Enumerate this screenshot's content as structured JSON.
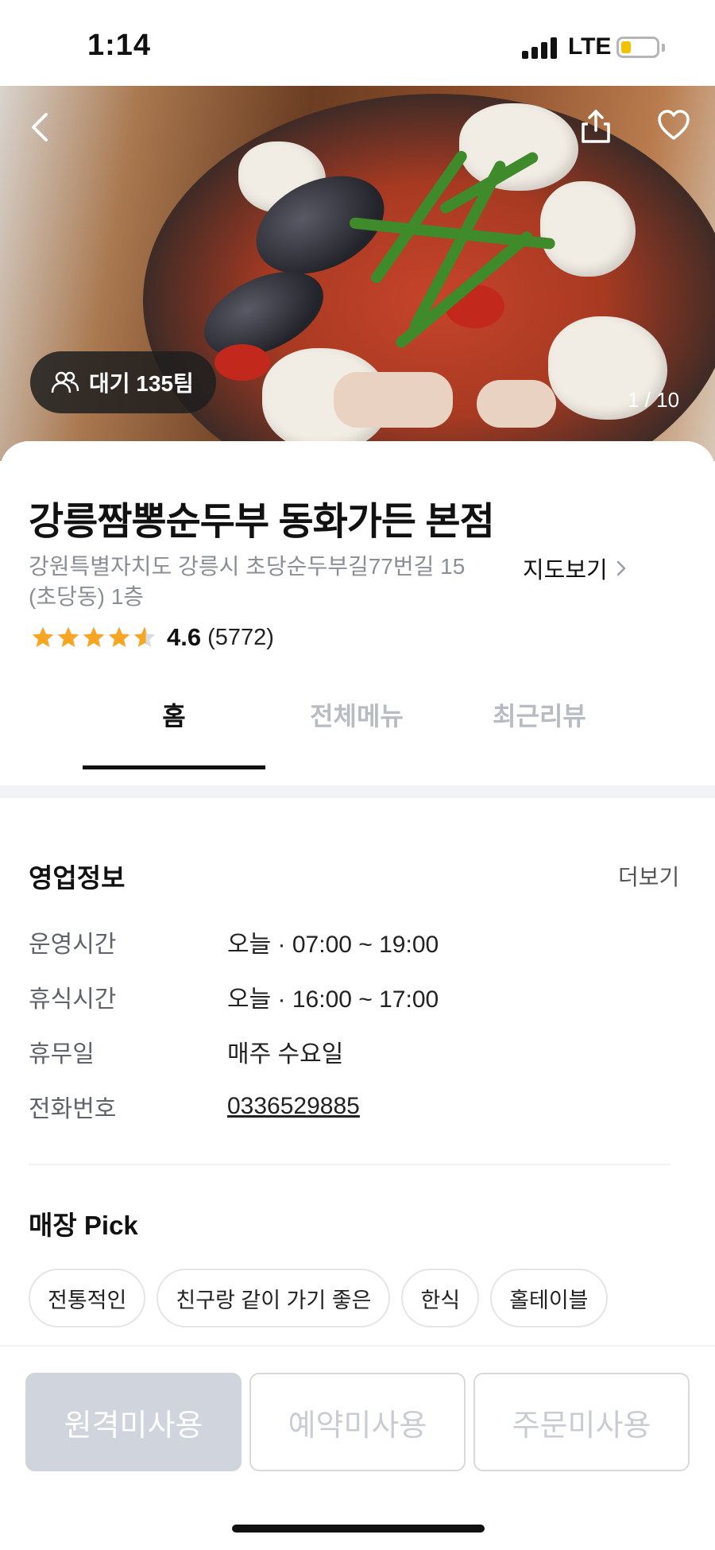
{
  "status_bar": {
    "time": "1:14",
    "network": "LTE",
    "battery_color": "#f2c200"
  },
  "hero": {
    "wait_badge": "대기 135팀",
    "page_indicator": "1 / 10"
  },
  "store": {
    "name": "강릉짬뽕순두부 동화가든 본점",
    "address_line1": "강원특별자치도 강릉시 초당순두부길77번길 15",
    "address_line2": "(초당동) 1층",
    "map_link": "지도보기",
    "rating": "4.6",
    "rating_value": 4.6,
    "review_count": "(5772)",
    "star_color": "#f6a623"
  },
  "tabs": [
    {
      "label": "홈",
      "active": true
    },
    {
      "label": "전체메뉴",
      "active": false
    },
    {
      "label": "최근리뷰",
      "active": false
    }
  ],
  "business_info": {
    "title": "영업정보",
    "more": "더보기",
    "rows": [
      {
        "label": "운영시간",
        "value": "오늘 · 07:00 ~ 19:00"
      },
      {
        "label": "휴식시간",
        "value": "오늘 · 16:00 ~ 17:00"
      },
      {
        "label": "휴무일",
        "value": "매주 수요일"
      },
      {
        "label": "전화번호",
        "value": "0336529885"
      }
    ]
  },
  "store_pick": {
    "title": "매장 Pick",
    "chips": [
      "전통적인",
      "친구랑 같이 가기 좋은",
      "한식",
      "홀테이블"
    ]
  },
  "bottom_buttons": [
    {
      "label": "원격미사용"
    },
    {
      "label": "예약미사용"
    },
    {
      "label": "주문미사용"
    }
  ]
}
